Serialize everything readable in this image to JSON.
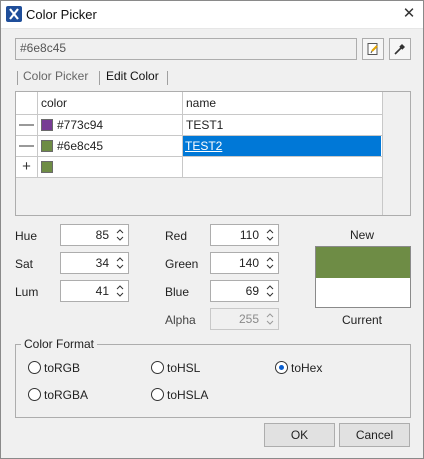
{
  "window": {
    "title": "Color Picker",
    "close_glyph": "✕"
  },
  "hex_field": {
    "value": "#6e8c45"
  },
  "tabs": [
    {
      "label": "Color Picker",
      "active": false
    },
    {
      "label": "Edit Color",
      "active": true
    }
  ],
  "table": {
    "columns": [
      "color",
      "name"
    ],
    "rows": [
      {
        "button": "—",
        "swatch": "#773c94",
        "color": "#773c94",
        "name": "TEST1",
        "selected": false
      },
      {
        "button": "—",
        "swatch": "#6e8c45",
        "color": "#6e8c45",
        "name": "TEST2",
        "selected": true
      }
    ],
    "add_row": {
      "button": "+",
      "swatch": "#6e8c45"
    }
  },
  "hsl": {
    "hue_label": "Hue",
    "hue": "85",
    "sat_label": "Sat",
    "sat": "34",
    "lum_label": "Lum",
    "lum": "41"
  },
  "rgb": {
    "red_label": "Red",
    "red": "110",
    "green_label": "Green",
    "green": "140",
    "blue_label": "Blue",
    "blue": "69",
    "alpha_label": "Alpha",
    "alpha": "255"
  },
  "preview": {
    "new_label": "New",
    "current_label": "Current",
    "new_color": "#6e8c45",
    "current_color": "#ffffff"
  },
  "color_format": {
    "title": "Color Format",
    "options": [
      {
        "label": "toRGB",
        "checked": false
      },
      {
        "label": "toHSL",
        "checked": false
      },
      {
        "label": "toHex",
        "checked": true
      },
      {
        "label": "toRGBA",
        "checked": false
      },
      {
        "label": "toHSLA",
        "checked": false
      }
    ]
  },
  "buttons": {
    "ok": "OK",
    "cancel": "Cancel"
  },
  "icons": {
    "app": "app-logo-icon",
    "pick": "paste-icon",
    "eyedropper": "eyedropper-icon"
  }
}
